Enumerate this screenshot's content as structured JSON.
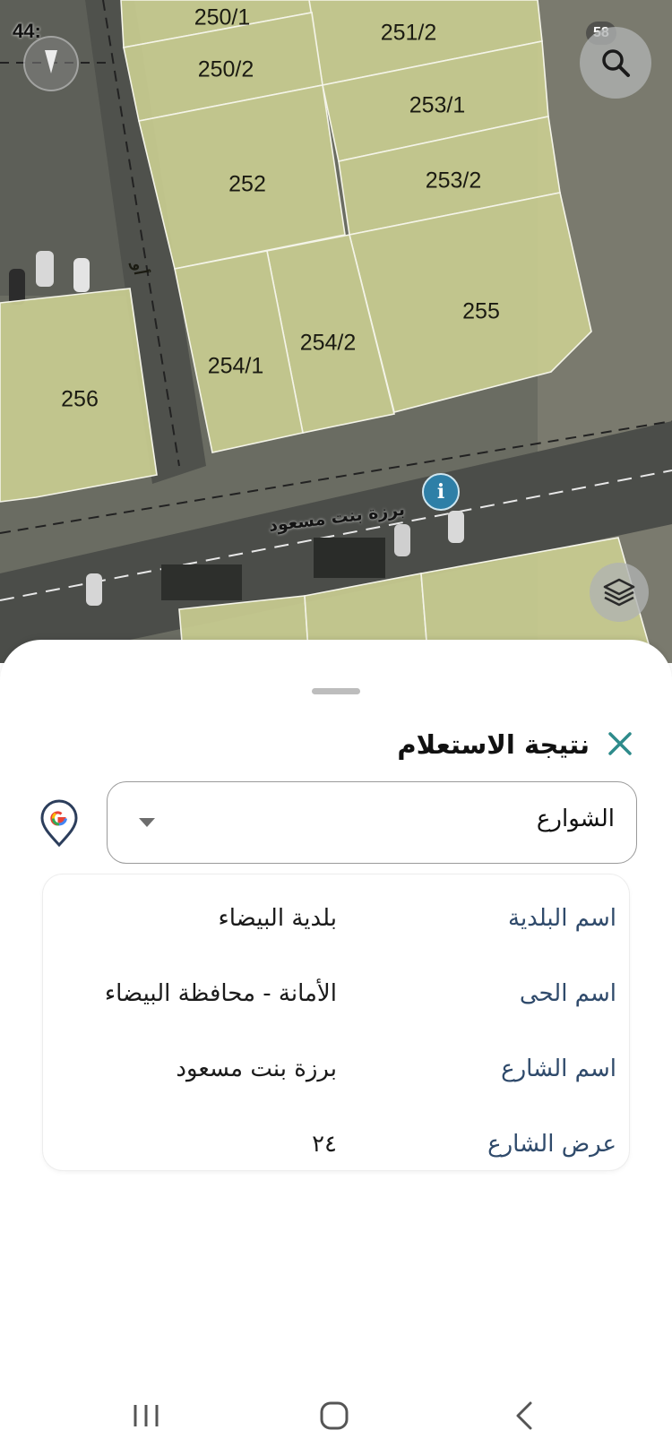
{
  "map": {
    "status_time": "44:",
    "notification_count": "58",
    "parcels": [
      "250/1",
      "251/2",
      "250/2",
      "253/1",
      "252",
      "253/2",
      "255",
      "254/2",
      "254/1",
      "256"
    ],
    "street_label": "برزة بنت مسعود",
    "side_road_label": "أو",
    "colors": {
      "parcel_fill": "#c8cb90",
      "road": "#4b4d49",
      "parcel_border": "#f4f4e8"
    }
  },
  "sheet": {
    "title": "نتيجة الاستعلام",
    "dropdown": {
      "selected": "الشوارع"
    },
    "rows": [
      {
        "label": "اسم البلدية",
        "value": "بلدية البيضاء"
      },
      {
        "label": "اسم الحى",
        "value": "الأمانة - محافظة البيضاء"
      },
      {
        "label": "اسم الشارع",
        "value": "برزة بنت مسعود"
      },
      {
        "label": "عرض الشارع",
        "value": "٢٤"
      }
    ],
    "colors": {
      "label": "#2f4a6b",
      "accent": "#2e8b8b"
    }
  },
  "icons": {
    "close": "close-icon",
    "search": "search-icon",
    "layers": "layers-icon",
    "compass": "compass-icon",
    "google": "google-icon",
    "info": "info-icon",
    "nav": [
      "recent-apps-icon",
      "home-icon",
      "back-icon"
    ]
  }
}
